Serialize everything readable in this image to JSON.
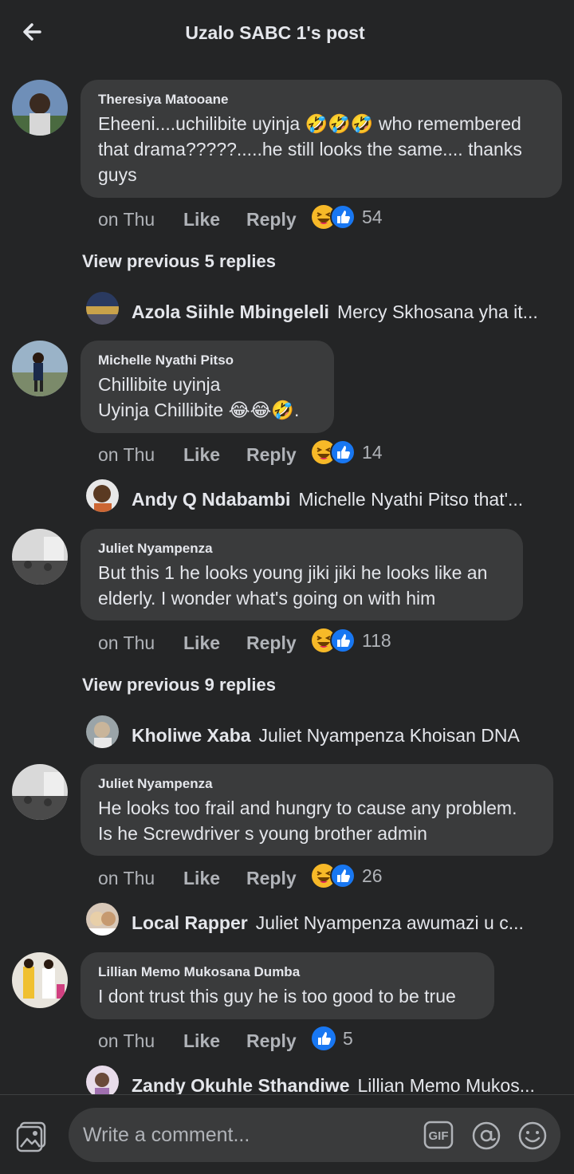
{
  "header": {
    "title": "Uzalo SABC 1's post"
  },
  "comments": [
    {
      "author": "Theresiya Matooane",
      "text": "Eheeni....uchilibite uyinja 🤣🤣🤣 who remembered that drama?????.....he still looks the same.... thanks guys",
      "time": "on Thu",
      "like": "Like",
      "reply": "Reply",
      "reaction_count": "54",
      "reactions": [
        "haha",
        "like"
      ]
    },
    {
      "author": "Michelle Nyathi Pitso",
      "text": "Chillibite uyinja\nUyinja Chillibite 😂😂🤣.",
      "time": "on Thu",
      "like": "Like",
      "reply": "Reply",
      "reaction_count": "14",
      "reactions": [
        "haha",
        "like"
      ]
    },
    {
      "author": "Juliet Nyampenza",
      "text": "But this 1 he looks young jiki jiki he looks like an elderly. I wonder what's going on with him",
      "time": "on Thu",
      "like": "Like",
      "reply": "Reply",
      "reaction_count": "118",
      "reactions": [
        "haha",
        "like"
      ]
    },
    {
      "author": "Juliet Nyampenza",
      "text": "He looks too frail and hungry to cause any problem. Is he Screwdriver s young brother admin",
      "time": "on Thu",
      "like": "Like",
      "reply": "Reply",
      "reaction_count": "26",
      "reactions": [
        "haha",
        "like"
      ]
    },
    {
      "author": "Lillian Memo Mukosana Dumba",
      "text": "I dont trust this guy he is too good to be true",
      "time": "on Thu",
      "like": "Like",
      "reply": "Reply",
      "reaction_count": "5",
      "reactions": [
        "like"
      ]
    }
  ],
  "view_previous": [
    "View previous 5 replies",
    "View previous 9 replies"
  ],
  "replies": [
    {
      "name": "Azola Siihle Mbingeleli",
      "preview": "Mercy Skhosana yha it..."
    },
    {
      "name": "Andy Q Ndabambi",
      "preview": "Michelle Nyathi Pitso that'..."
    },
    {
      "name": "Kholiwe Xaba",
      "preview": "Juliet Nyampenza Khoisan DNA"
    },
    {
      "name": "Local Rapper",
      "preview": "Juliet Nyampenza awumazi u c..."
    },
    {
      "name": "Zandy Okuhle Sthandiwe",
      "preview": "Lillian Memo Mukos..."
    }
  ],
  "composer": {
    "placeholder": "Write a comment...",
    "gif_label": "GIF"
  },
  "colors": {
    "background": "#242526",
    "bubble": "#3a3b3c",
    "like_blue": "#1877f2",
    "haha_yellow": "#f7b928"
  },
  "icons": [
    "back-arrow-icon",
    "haha-reaction-icon",
    "like-reaction-icon",
    "photo-icon",
    "gif-icon",
    "at-mention-icon",
    "emoji-icon"
  ]
}
